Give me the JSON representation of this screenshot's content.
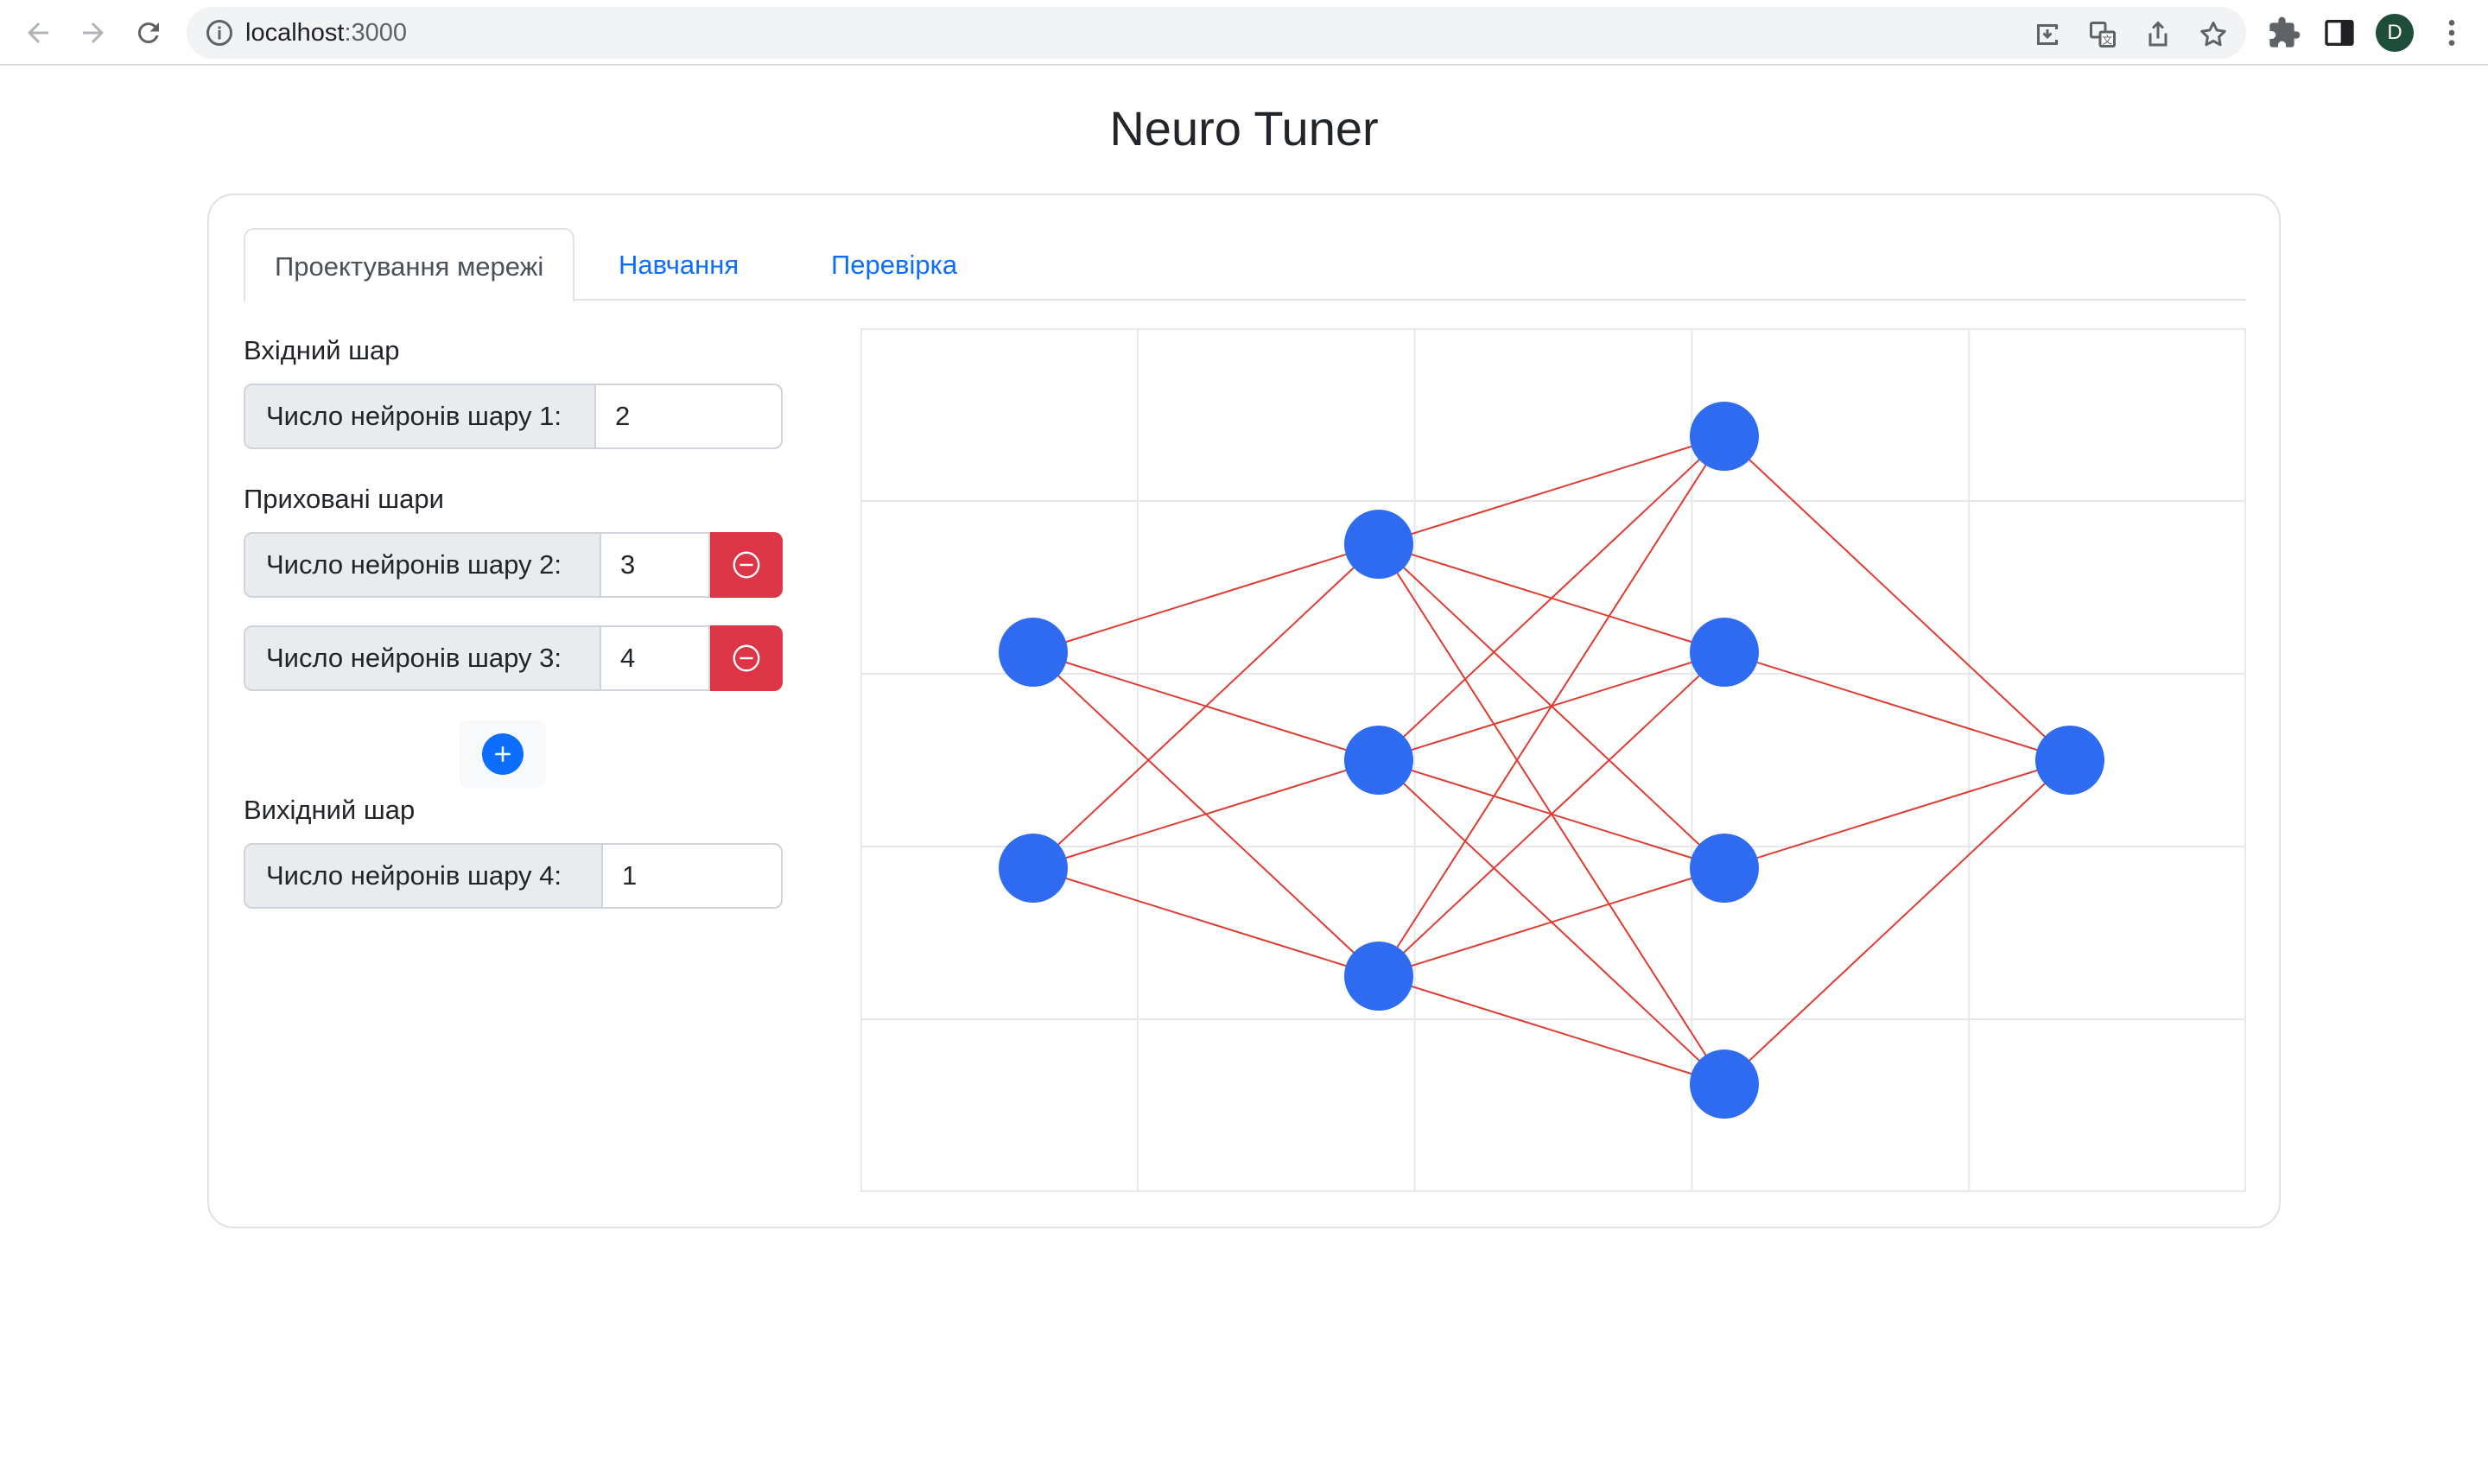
{
  "browser": {
    "url_host": "localhost",
    "url_port": ":3000",
    "profile_initial": "D"
  },
  "app": {
    "title": "Neuro Tuner"
  },
  "tabs": [
    {
      "label": "Проектування мережі",
      "active": true
    },
    {
      "label": "Навчання",
      "active": false
    },
    {
      "label": "Перевірка",
      "active": false
    }
  ],
  "form": {
    "input_section": "Вхідний шар",
    "hidden_section": "Приховані шари",
    "output_section": "Вихідний шар",
    "layers": [
      {
        "label": "Число нейронів шару 1:",
        "value": "2"
      },
      {
        "label": "Число нейронів шару 2:",
        "value": "3"
      },
      {
        "label": "Число нейронів шару 3:",
        "value": "4"
      },
      {
        "label": "Число нейронів шару 4:",
        "value": "1"
      }
    ]
  },
  "network": {
    "layer_sizes": [
      2,
      3,
      4,
      1
    ],
    "node_color": "#2f6bf0",
    "edge_color": "#e03a2f",
    "grid_color": "#e6e8eb",
    "grid_columns": 5,
    "grid_rows": 5
  },
  "colors": {
    "primary": "#0d6efd",
    "danger": "#dc3545"
  }
}
